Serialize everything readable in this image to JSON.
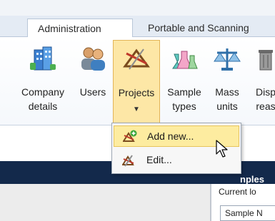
{
  "tabs": [
    {
      "label": "Administration",
      "active": true
    },
    {
      "label": "Portable and Scanning",
      "active": false
    }
  ],
  "ribbon": {
    "buttons": [
      {
        "label_line1": "Company",
        "label_line2": "details",
        "icon": "building-icon"
      },
      {
        "label_line1": "Users",
        "label_line2": "",
        "icon": "users-icon"
      },
      {
        "label_line1": "Projects",
        "label_line2": "",
        "icon": "projects-icon",
        "has_dropdown": true,
        "pressed": true
      },
      {
        "label_line1": "Sample",
        "label_line2": "types",
        "icon": "flasks-icon"
      },
      {
        "label_line1": "Mass",
        "label_line2": "units",
        "icon": "scale-icon"
      },
      {
        "label_line1": "Disp",
        "label_line2": "reas",
        "icon": "bin-icon"
      }
    ]
  },
  "dropdown": {
    "items": [
      {
        "label": "Add new...",
        "icon": "add-project-icon",
        "highlighted": true
      },
      {
        "label": "Edit...",
        "icon": "edit-project-icon",
        "highlighted": false
      }
    ]
  },
  "main": {
    "section_title": "nples",
    "current_label": "Current lo",
    "field_value": "Sample N"
  },
  "colors": {
    "accent_dark": "#13294b",
    "highlight": "#fdeca0",
    "tab_bar": "#e4ebf4"
  }
}
